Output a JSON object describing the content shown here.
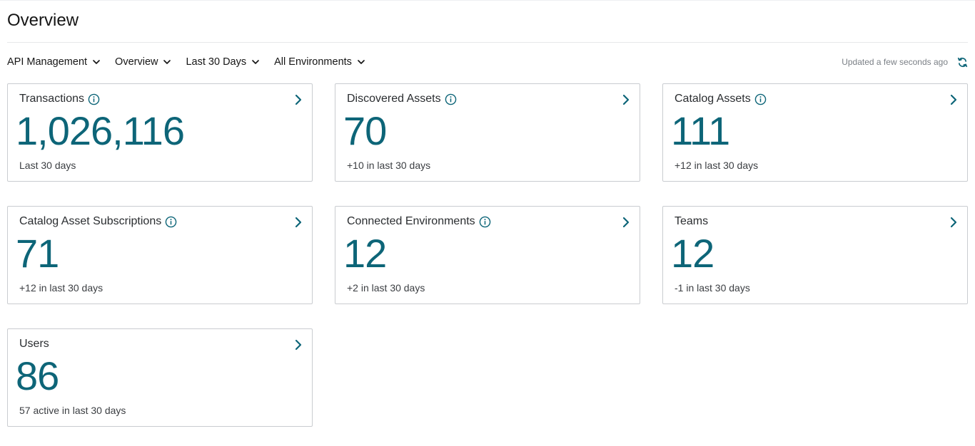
{
  "page": {
    "title": "Overview"
  },
  "filters": [
    {
      "label": "API Management",
      "icon": "chevron-down-icon"
    },
    {
      "label": "Overview",
      "icon": "chevron-down-icon"
    },
    {
      "label": "Last 30 Days",
      "icon": "chevron-down-icon"
    },
    {
      "label": "All Environments",
      "icon": "chevron-down-icon"
    }
  ],
  "status": {
    "updated_text": "Updated a few seconds ago",
    "refresh_icon": "refresh-icon"
  },
  "colors": {
    "accent": "#0d6578",
    "card_border": "#c9ccd0",
    "muted_text": "#7a7f85"
  },
  "cards": [
    {
      "title": "Transactions",
      "has_info": true,
      "value": "1,026,116",
      "sub": "Last 30 days"
    },
    {
      "title": "Discovered Assets",
      "has_info": true,
      "value": "70",
      "sub": "+10 in last 30 days"
    },
    {
      "title": "Catalog Assets",
      "has_info": true,
      "value": "111",
      "sub": "+12 in last 30 days"
    },
    {
      "title": "Catalog Asset Subscriptions",
      "has_info": true,
      "value": "71",
      "sub": "+12 in last 30 days"
    },
    {
      "title": "Connected Environments",
      "has_info": true,
      "value": "12",
      "sub": "+2 in last 30 days"
    },
    {
      "title": "Teams",
      "has_info": false,
      "value": "12",
      "sub": "-1 in last 30 days"
    },
    {
      "title": "Users",
      "has_info": false,
      "value": "86",
      "sub": "57 active in last 30 days"
    }
  ]
}
